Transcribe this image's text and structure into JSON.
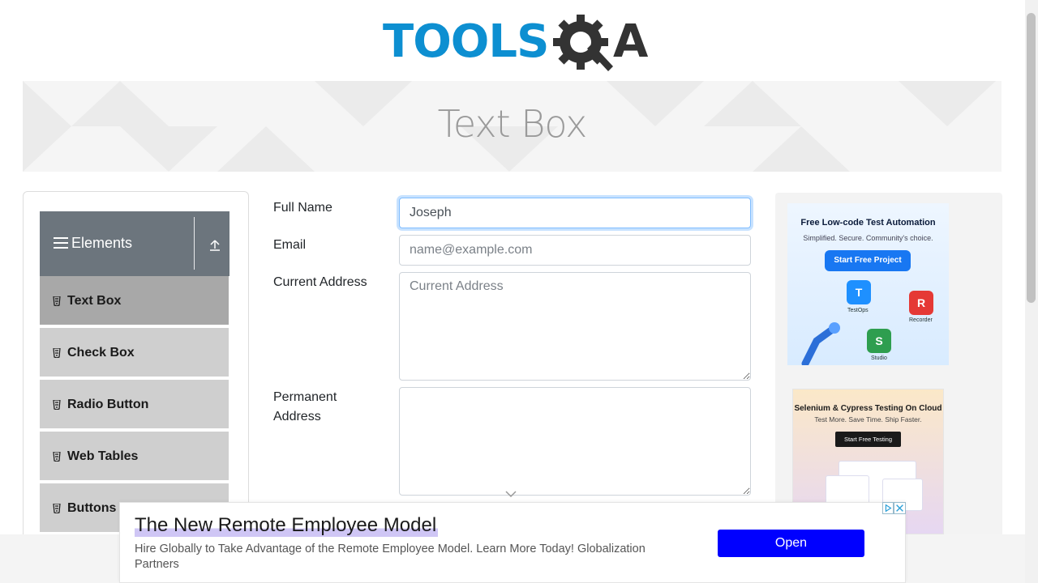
{
  "header": {
    "logo_text": "TOOLS",
    "logo_suffix": "A",
    "logo_gear_letter": "Q"
  },
  "banner": {
    "title": "Text Box"
  },
  "sidebar": {
    "group_label": "Elements",
    "items": [
      {
        "label": "Text Box",
        "active": true
      },
      {
        "label": "Check Box"
      },
      {
        "label": "Radio Button"
      },
      {
        "label": "Web Tables"
      },
      {
        "label": "Buttons"
      }
    ]
  },
  "form": {
    "full_name": {
      "label": "Full Name",
      "value": "Joseph",
      "placeholder": "Full Name"
    },
    "email": {
      "label": "Email",
      "value": "",
      "placeholder": "name@example.com"
    },
    "current_address": {
      "label": "Current Address",
      "value": "",
      "placeholder": "Current Address"
    },
    "permanent_address": {
      "label_line1": "Permanent",
      "label_line2": "Address",
      "value": "",
      "placeholder": ""
    }
  },
  "right_ads": {
    "ad1": {
      "title": "Free Low-code Test Automation",
      "subtitle": "Simplified. Secure. Community's choice.",
      "button": "Start Free Project",
      "tiles": [
        "TestOps",
        "Recorder",
        "Studio"
      ]
    },
    "ad2": {
      "title": "Selenium & Cypress Testing On Cloud",
      "subtitle": "Test More. Save Time. Ship Faster.",
      "button": "Start Free Testing"
    }
  },
  "bottom_ad": {
    "headline": "The New Remote Employee Model",
    "description": "Hire Globally to Take Advantage of the Remote Employee Model. Learn More Today! Globalization Partners",
    "button": "Open"
  },
  "colors": {
    "logo_blue": "#0d8fd1",
    "logo_dark": "#333333",
    "sidebar_header": "#6c757d",
    "menu_item": "#cfcfcf",
    "menu_item_active": "#a8a8a8",
    "open_button": "#0000ff"
  }
}
